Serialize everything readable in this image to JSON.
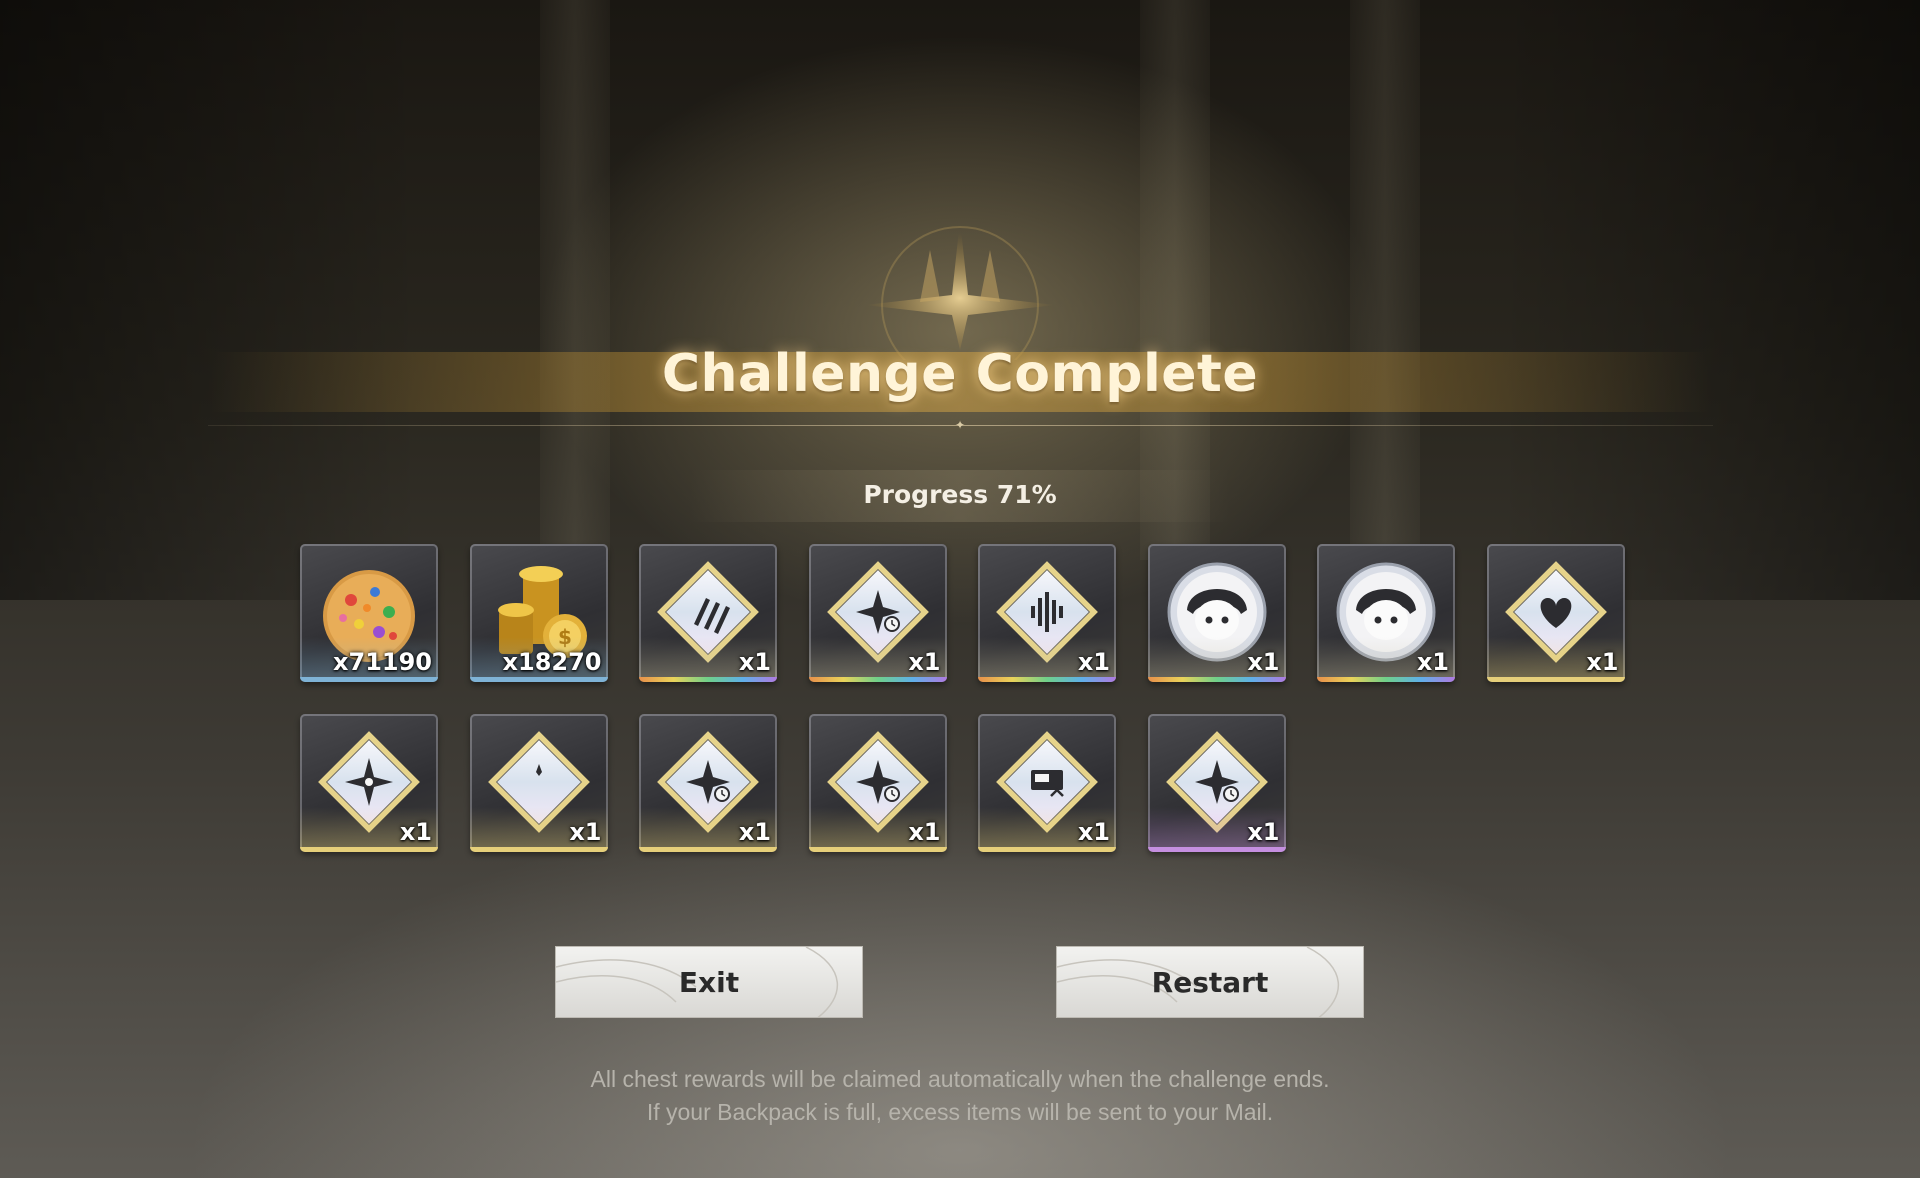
{
  "title": "Challenge Complete",
  "progress": "Progress 71%",
  "rewards": {
    "row1": [
      {
        "icon": "cookie-icon",
        "qty": "x71190",
        "rarity_color": "#7fb3d6"
      },
      {
        "icon": "gold-coins-icon",
        "qty": "x18270",
        "rarity_color": "#7fb3d6"
      },
      {
        "icon": "bullets-icon",
        "qty": "x1",
        "rarity_color": "rainbow"
      },
      {
        "icon": "star-clock-icon",
        "qty": "x1",
        "rarity_color": "rainbow"
      },
      {
        "icon": "soundwave-icon",
        "qty": "x1",
        "rarity_color": "rainbow"
      },
      {
        "icon": "character-portrait-icon",
        "qty": "x1",
        "rarity_color": "rainbow"
      },
      {
        "icon": "character-portrait-icon",
        "qty": "x1",
        "rarity_color": "rainbow"
      },
      {
        "icon": "heart-hand-icon",
        "qty": "x1",
        "rarity_color": "#e6cf7a"
      }
    ],
    "row2": [
      {
        "icon": "compass-star-icon",
        "qty": "x1",
        "rarity_color": "#e6cf7a"
      },
      {
        "icon": "crescent-shield-icon",
        "qty": "x1",
        "rarity_color": "#e6cf7a"
      },
      {
        "icon": "star-clock-icon",
        "qty": "x1",
        "rarity_color": "#e6cf7a"
      },
      {
        "icon": "star-clock-icon",
        "qty": "x1",
        "rarity_color": "#e6cf7a"
      },
      {
        "icon": "monitor-arrow-icon",
        "qty": "x1",
        "rarity_color": "#e6cf7a"
      },
      {
        "icon": "star-clock-icon",
        "qty": "x1",
        "rarity_color": "#c58fe0"
      }
    ]
  },
  "buttons": {
    "exit": "Exit",
    "restart": "Restart"
  },
  "notes": {
    "line1": "All chest rewards will be claimed automatically when the challenge ends.",
    "line2": "If your Backpack is full, excess items will be sent to your Mail."
  }
}
